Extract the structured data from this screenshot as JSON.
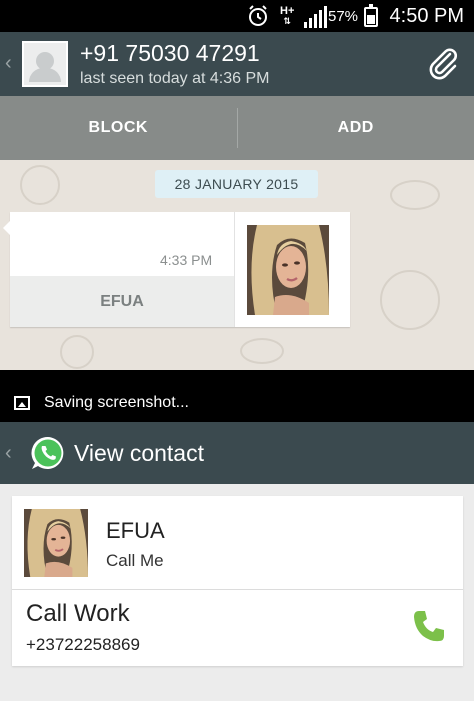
{
  "status_bar": {
    "battery_percent": "57%",
    "battery_level": 0.57,
    "network_type": "H+",
    "time": "4:50 PM",
    "icons": [
      "alarm-icon",
      "network-icon",
      "signal-icon",
      "battery-icon"
    ]
  },
  "chat_header": {
    "phone": "+91 75030 47291",
    "last_seen": "last seen today at 4:36 PM",
    "icons": [
      "back-chevron-icon",
      "default-avatar-icon",
      "paperclip-icon"
    ]
  },
  "actions": {
    "block_label": "BLOCK",
    "add_label": "ADD"
  },
  "chat": {
    "date_chip": "28 JANUARY 2015",
    "message": {
      "time": "4:33 PM",
      "contact_name": "EFUA"
    }
  },
  "toast": {
    "text": "Saving screenshot..."
  },
  "view_contact": {
    "title": "View contact",
    "contact": {
      "name": "EFUA",
      "status": "Call Me"
    },
    "call": {
      "label": "Call Work",
      "number": "+23722258869"
    }
  },
  "colors": {
    "header_bg": "#3b4a4f",
    "action_bar_bg": "#878b89",
    "chat_bg": "#e8e3dc",
    "date_chip_bg": "#dff0f6",
    "whatsapp_green": "#4bc25a",
    "phone_green": "#7cc04a"
  }
}
